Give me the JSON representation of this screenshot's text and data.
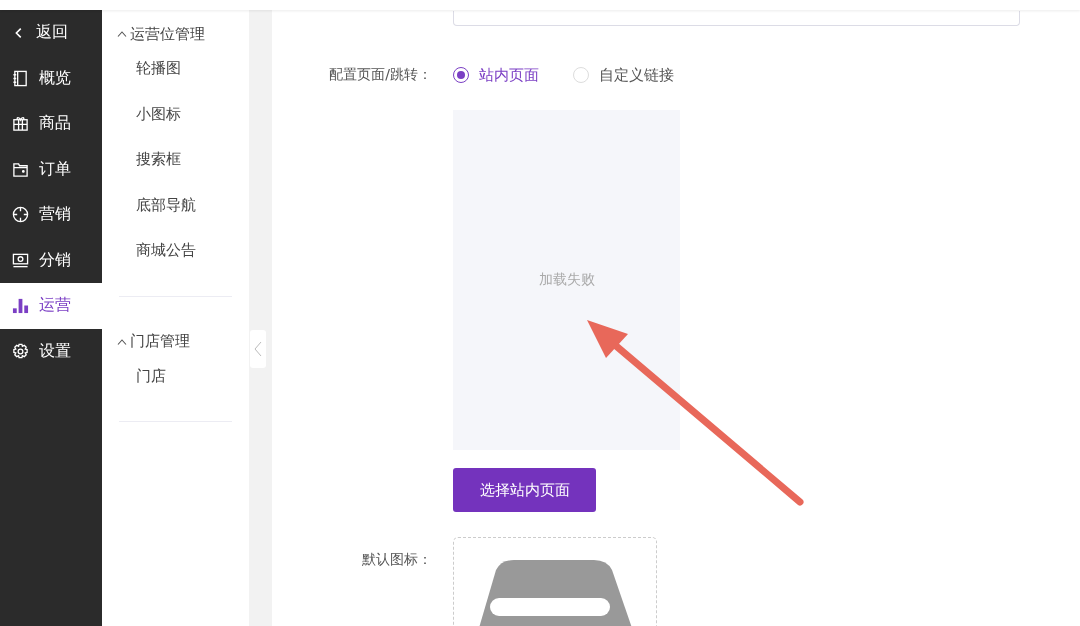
{
  "sidebar": {
    "back": {
      "label": "返回"
    },
    "items": [
      {
        "label": "概览",
        "selected": false
      },
      {
        "label": "商品",
        "selected": false
      },
      {
        "label": "订单",
        "selected": false
      },
      {
        "label": "营销",
        "selected": false
      },
      {
        "label": "分销",
        "selected": false
      },
      {
        "label": "运营",
        "selected": true
      },
      {
        "label": "设置",
        "selected": false
      }
    ]
  },
  "subnav": {
    "groups": [
      {
        "title": "运营位管理",
        "expanded": true,
        "items": [
          "轮播图",
          "小图标",
          "搜索框",
          "底部导航",
          "商城公告"
        ]
      },
      {
        "title": "门店管理",
        "expanded": true,
        "items": [
          "门店"
        ]
      }
    ]
  },
  "form": {
    "link_type": {
      "label": "配置页面/跳转：",
      "options": [
        {
          "label": "站内页面",
          "selected": true
        },
        {
          "label": "自定义链接",
          "selected": false
        }
      ]
    },
    "preview": {
      "message": "加载失败"
    },
    "select_button": "选择站内页面",
    "default_icon": {
      "label": "默认图标："
    }
  }
}
